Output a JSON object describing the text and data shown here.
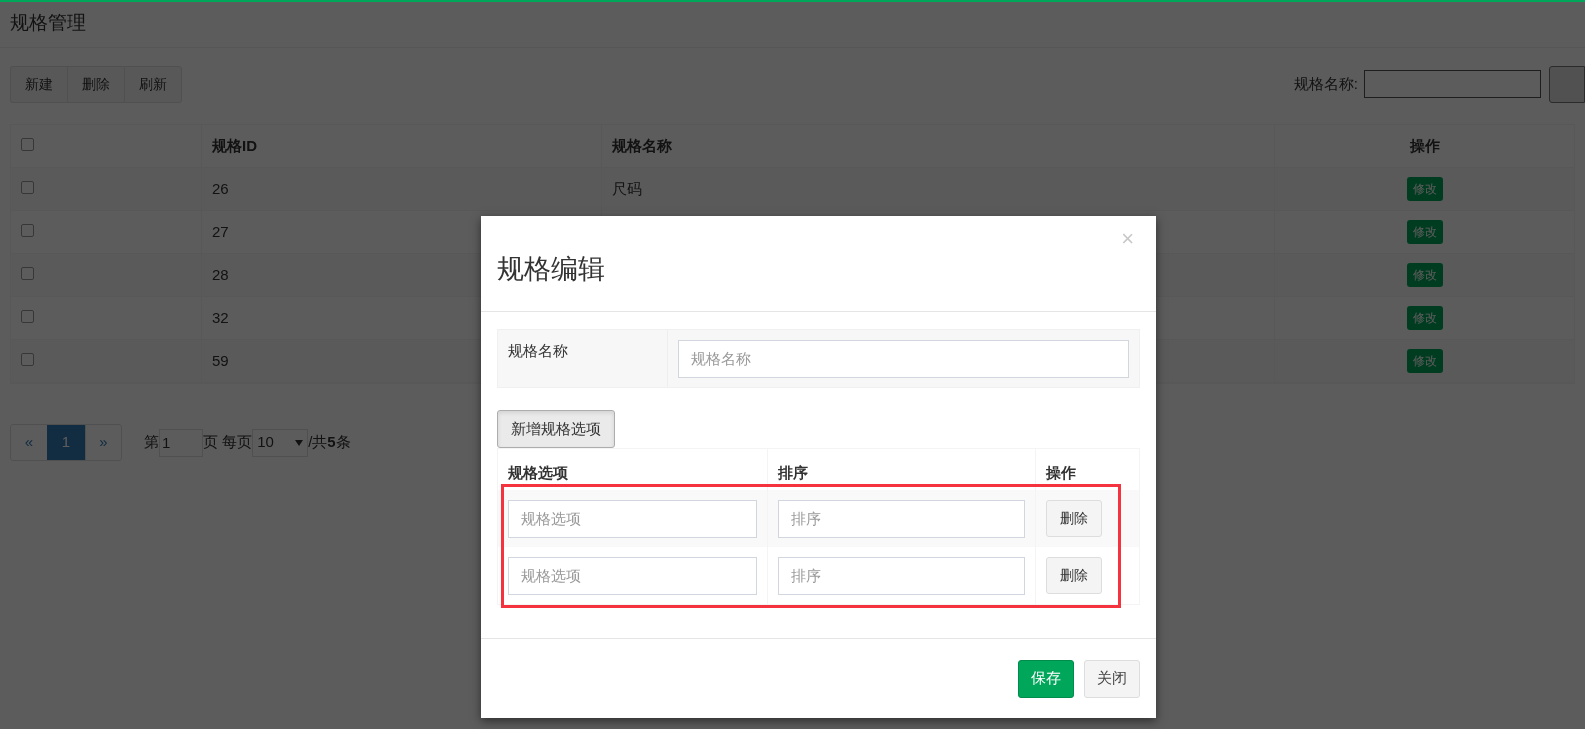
{
  "page": {
    "title": "规格管理"
  },
  "toolbar": {
    "buttons": [
      "新建",
      "删除",
      "刷新"
    ]
  },
  "search": {
    "label": "规格名称:"
  },
  "table": {
    "columns": [
      "规格ID",
      "规格名称",
      "操作"
    ],
    "header_checked": false,
    "rows": [
      {
        "checked": false,
        "id": "26",
        "name": "尺码",
        "action": "修改"
      },
      {
        "checked": false,
        "id": "27",
        "action": "修改"
      },
      {
        "checked": false,
        "id": "28",
        "action": "修改"
      },
      {
        "checked": false,
        "id": "32",
        "action": "修改"
      },
      {
        "checked": false,
        "id": "59",
        "action": "修改"
      }
    ]
  },
  "pagination": {
    "prev": "«",
    "pages": [
      {
        "label": "1",
        "selected": true
      }
    ],
    "next": "»",
    "page_prefix": "第",
    "page_value": "1",
    "page_suffix": "页 每页",
    "page_size": "10",
    "total": "/共**5**条"
  },
  "modal": {
    "title": "规格编辑",
    "close": "×",
    "name_label": "规格名称",
    "name_placeholder": "规格名称",
    "add_button": "新增规格选项",
    "options_table": {
      "columns": [
        "规格选项",
        "排序",
        "操作"
      ],
      "highlighted": true,
      "rows": [
        {
          "option_placeholder": "规格选项",
          "order_placeholder": "排序",
          "delete": "删除"
        },
        {
          "option_placeholder": "规格选项",
          "order_placeholder": "排序",
          "delete": "删除"
        }
      ]
    },
    "buttons": [
      {
        "label": "保存",
        "kind": "primary"
      },
      {
        "label": "关闭",
        "kind": "default"
      }
    ]
  }
}
